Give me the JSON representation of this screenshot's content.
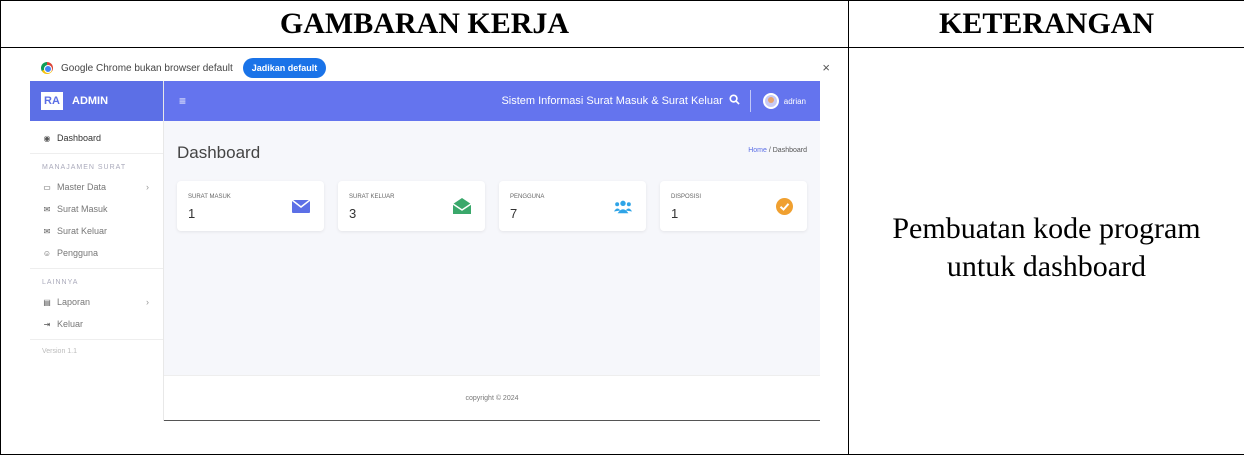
{
  "doc": {
    "col1_header": "GAMBARAN KERJA",
    "col2_header": "KETERANGAN",
    "description_line1": "Pembuatan kode program",
    "description_line2": "untuk dashboard"
  },
  "infobar": {
    "message": "Google Chrome bukan browser default",
    "button": "Jadikan default",
    "close": "×"
  },
  "brand": {
    "logo": "RA",
    "name": "ADMIN"
  },
  "topbar": {
    "menu_icon": "≡",
    "title": "Sistem Informasi Surat Masuk & Surat Keluar",
    "search_icon": "search-icon",
    "user": "adrian"
  },
  "sidebar": {
    "dashboard": "Dashboard",
    "section1": "MANAJAMEN SURAT",
    "master_data": "Master Data",
    "surat_masuk": "Surat Masuk",
    "surat_keluar": "Surat Keluar",
    "pengguna": "Pengguna",
    "section2": "LAINNYA",
    "laporan": "Laporan",
    "keluar": "Keluar",
    "version": "Version 1.1"
  },
  "main": {
    "page_title": "Dashboard",
    "breadcrumb_home": "Home",
    "breadcrumb_sep": "/",
    "breadcrumb_current": "Dashboard",
    "footer": "copyright © 2024"
  },
  "cards": [
    {
      "label": "SURAT MASUK",
      "value": "1",
      "icon": "envelope-icon",
      "color": "#5c6fe6"
    },
    {
      "label": "SURAT KELUAR",
      "value": "3",
      "icon": "envelope-open-icon",
      "color": "#3aa86b"
    },
    {
      "label": "PENGGUNA",
      "value": "7",
      "icon": "users-icon",
      "color": "#2fa4e7"
    },
    {
      "label": "DISPOSISI",
      "value": "1",
      "icon": "check-circle-icon",
      "color": "#f0a030"
    }
  ]
}
